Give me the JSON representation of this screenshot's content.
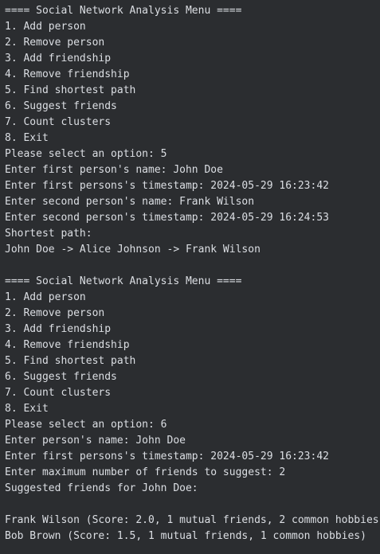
{
  "console": {
    "lines": [
      "==== Social Network Analysis Menu ====",
      "1. Add person",
      "2. Remove person",
      "3. Add friendship",
      "4. Remove friendship",
      "5. Find shortest path",
      "6. Suggest friends",
      "7. Count clusters",
      "8. Exit",
      "Please select an option: 5",
      "Enter first person's name: John Doe",
      "Enter first persons's timestamp: 2024-05-29 16:23:42",
      "Enter second person's name: Frank Wilson",
      "Enter second person's timestamp: 2024-05-29 16:24:53",
      "Shortest path:",
      "John Doe -> Alice Johnson -> Frank Wilson",
      "",
      "==== Social Network Analysis Menu ====",
      "1. Add person",
      "2. Remove person",
      "3. Add friendship",
      "4. Remove friendship",
      "5. Find shortest path",
      "6. Suggest friends",
      "7. Count clusters",
      "8. Exit",
      "Please select an option: 6",
      "Enter person's name: John Doe",
      "Enter first persons's timestamp: 2024-05-29 16:23:42",
      "Enter maximum number of friends to suggest: 2",
      "Suggested friends for John Doe:",
      "",
      "Frank Wilson (Score: 2.0, 1 mutual friends, 2 common hobbies)",
      "Bob Brown (Score: 1.5, 1 mutual friends, 1 common hobbies)"
    ]
  }
}
